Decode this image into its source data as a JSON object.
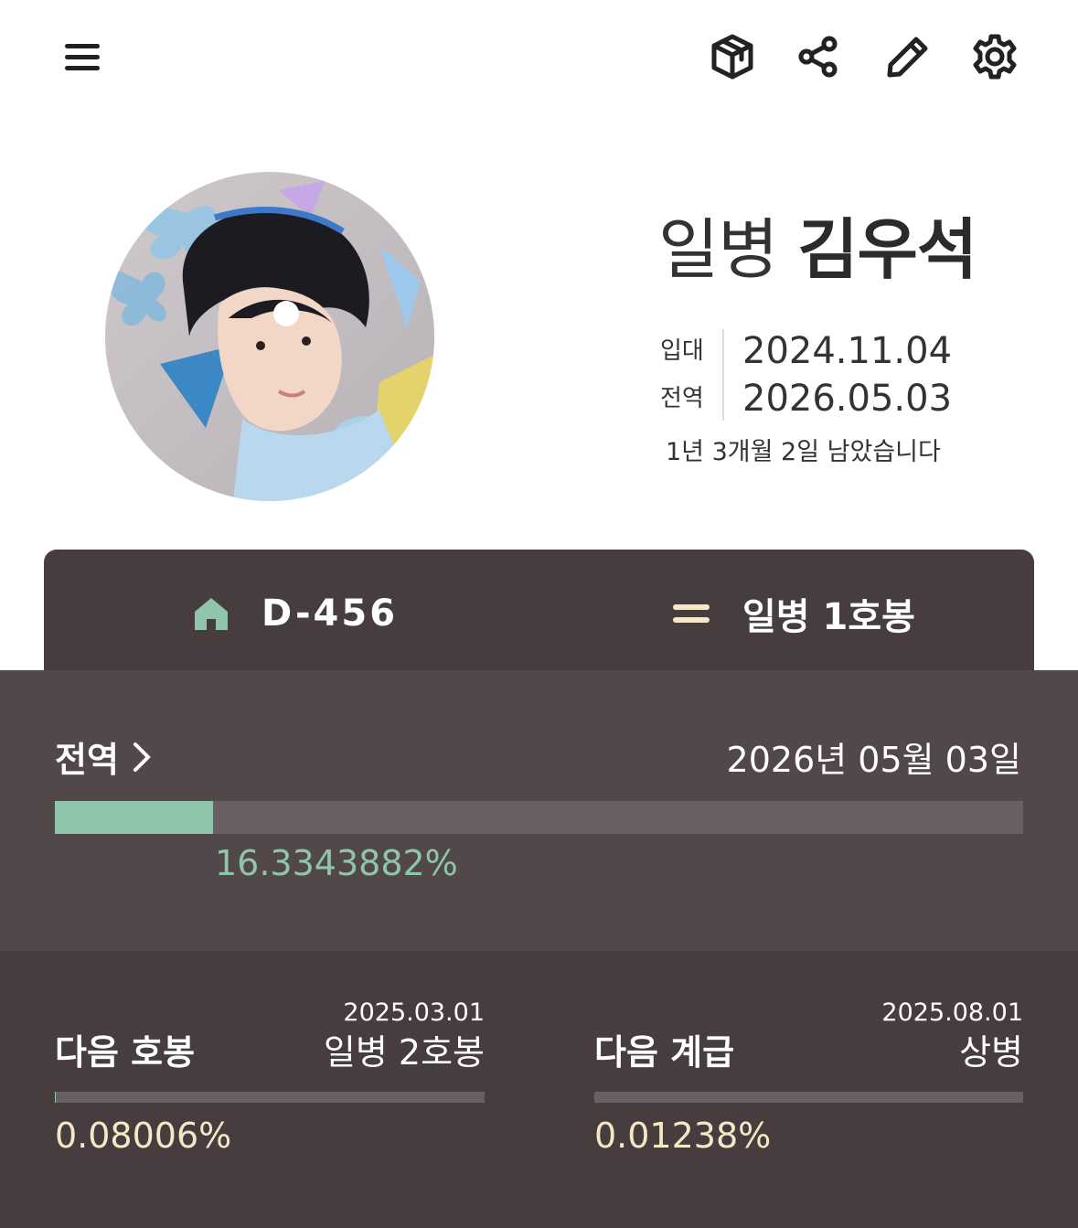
{
  "colors": {
    "accent_green": "#8ec5ab",
    "card_dark": "#473d3e",
    "card_mid": "#524849",
    "track": "#6a6061",
    "cream": "#f6e7c6"
  },
  "toolbar": {
    "menu_icon": "hamburger-menu-icon",
    "actions": [
      "box-icon",
      "share-icon",
      "pencil-icon",
      "settings-gear-icon"
    ]
  },
  "profile": {
    "rank": "일병",
    "name": "김우석",
    "enlist_label": "입대",
    "enlist_date": "2024.11.04",
    "discharge_label": "전역",
    "discharge_date": "2026.05.03",
    "remaining": "1년 3개월 2일 남았습니다"
  },
  "tabs": [
    {
      "icon": "home-icon",
      "label": "D-456"
    },
    {
      "icon": "rank-stripes-icon",
      "label": "일병 1호봉"
    }
  ],
  "discharge_progress": {
    "title": "전역",
    "date": "2026년 05월 03일",
    "percent_text": "16.3343882%",
    "fraction": 0.163343882
  },
  "next_step": {
    "label": "다음 호봉",
    "date": "2025.03.01",
    "value": "일병 2호봉",
    "percent_text": "0.08006%",
    "fraction": 0.0008006
  },
  "next_rank": {
    "label": "다음 계급",
    "date": "2025.08.01",
    "value": "상병",
    "percent_text": "0.01238%",
    "fraction": 0.0001238
  }
}
